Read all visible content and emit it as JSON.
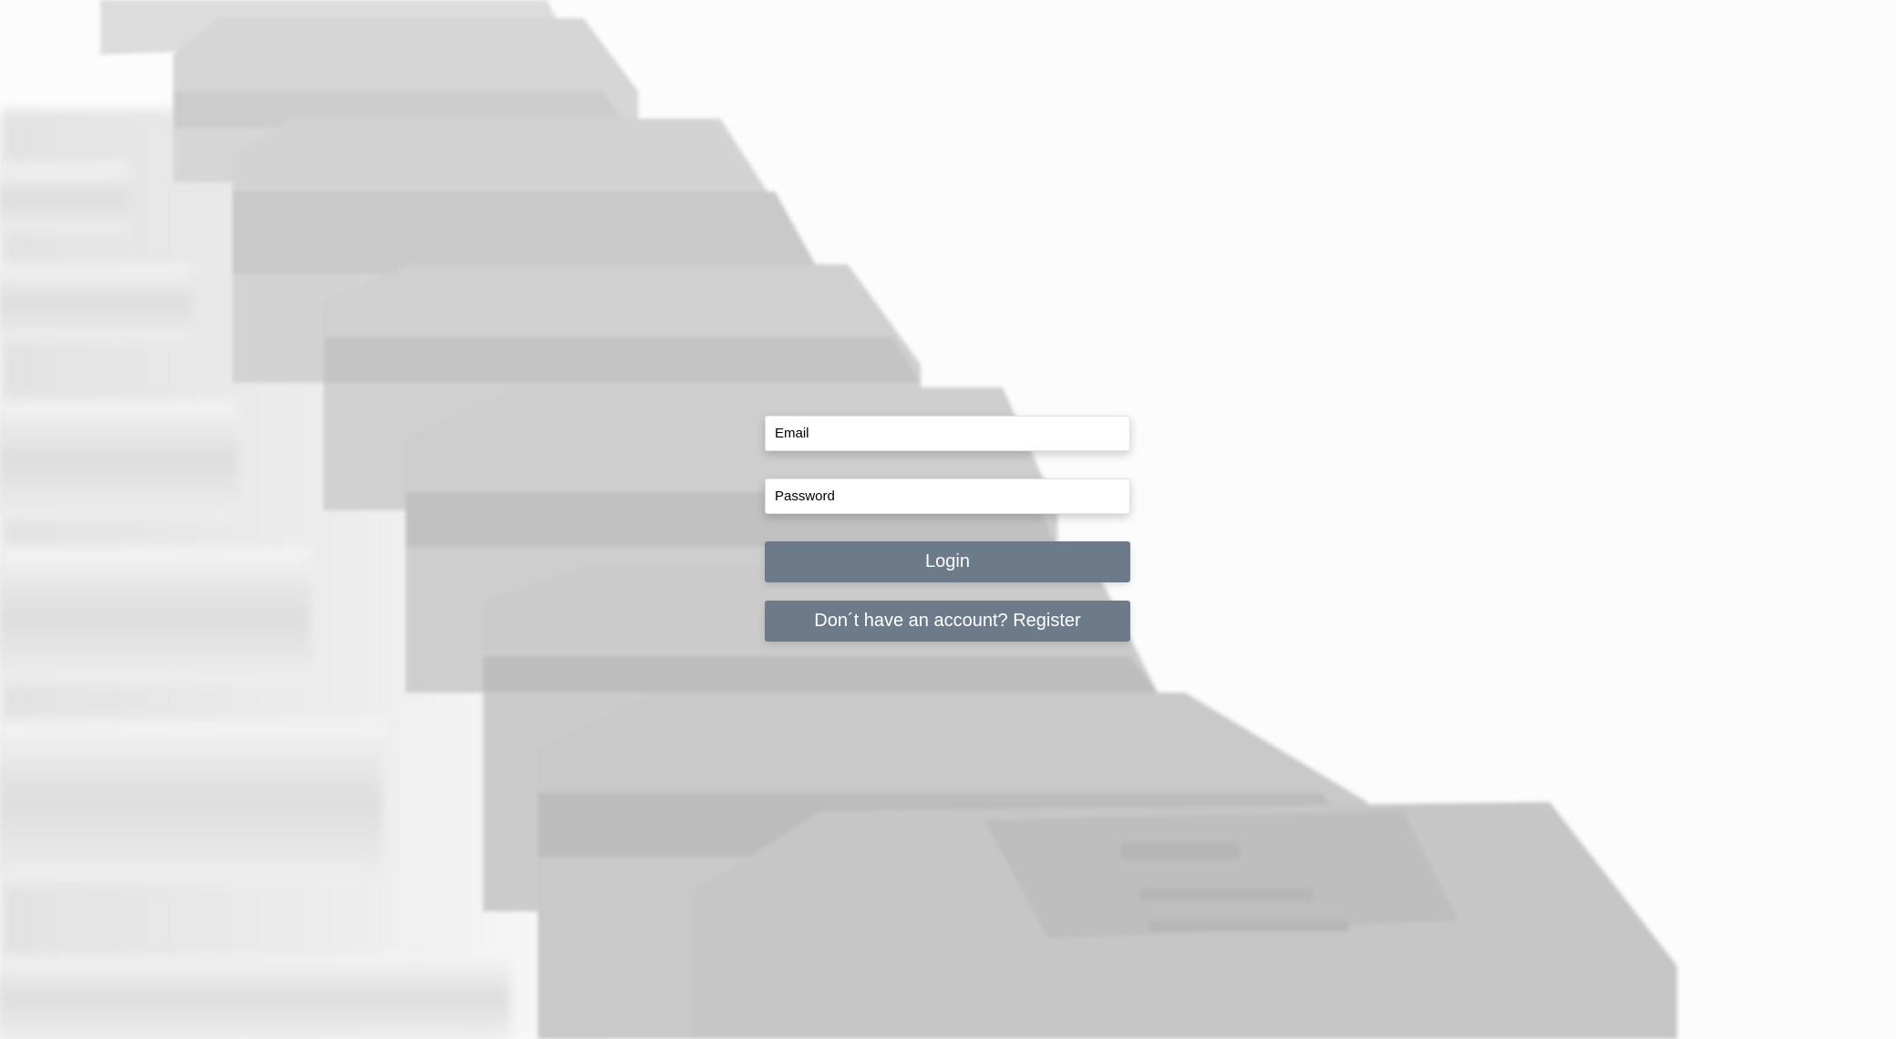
{
  "login_form": {
    "email_placeholder": "Email",
    "email_value": "",
    "password_placeholder": "Password",
    "password_value": "",
    "login_label": "Login",
    "register_label": "Don´t have an account? Register"
  },
  "background": {
    "image": "dumbbell-rack-photo",
    "tone": "grayscale"
  },
  "colors": {
    "button": "#6c7a89",
    "button_text": "#ffffff",
    "field_bg": "#ffffff"
  }
}
